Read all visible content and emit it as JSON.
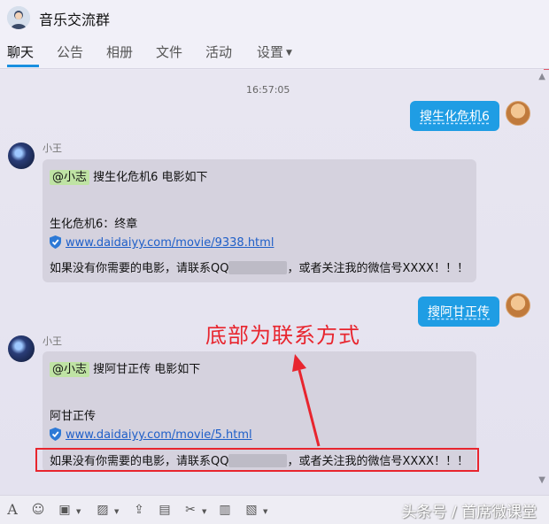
{
  "header": {
    "group_name": "音乐交流群"
  },
  "tabs": [
    {
      "label": "聊天"
    },
    {
      "label": "公告"
    },
    {
      "label": "相册"
    },
    {
      "label": "文件"
    },
    {
      "label": "活动"
    },
    {
      "label": "设置"
    }
  ],
  "chat": {
    "timestamp": "16:57:05",
    "out1": {
      "text": "搜生化危机6"
    },
    "in1": {
      "sender": "小王",
      "mention": "@小志",
      "request": " 搜生化危机6 电影如下",
      "title": "生化危机6：终章",
      "link": "www.daidaiyy.com/movie/9338.html",
      "contact_prefix": "如果没有你需要的电影，请联系QQ",
      "contact_suffix": "，或者关注我的微信号XXXX！！！"
    },
    "out2": {
      "text": "搜阿甘正传"
    },
    "in2": {
      "sender": "小王",
      "mention": "@小志",
      "request": " 搜阿甘正传 电影如下",
      "title": "阿甘正传",
      "link": "www.daidaiyy.com/movie/5.html",
      "contact_prefix": "如果没有你需要的电影，请联系QQ",
      "contact_suffix": "，或者关注我的微信号XXXX！！！"
    }
  },
  "annotation": {
    "text": "底部为联系方式",
    "color": "#e8252e"
  },
  "watermark": "头条号 / 首席微课堂",
  "colors": {
    "accent": "#1a8fe0",
    "bubble_out": "#1f9de4",
    "bubble_in": "#d5d2de"
  },
  "toolbar_icons": [
    "font-icon",
    "emoji-icon",
    "screenshot-icon",
    "image-icon",
    "upload-icon",
    "gift-icon",
    "scissors-icon",
    "history-icon",
    "more-icon"
  ]
}
